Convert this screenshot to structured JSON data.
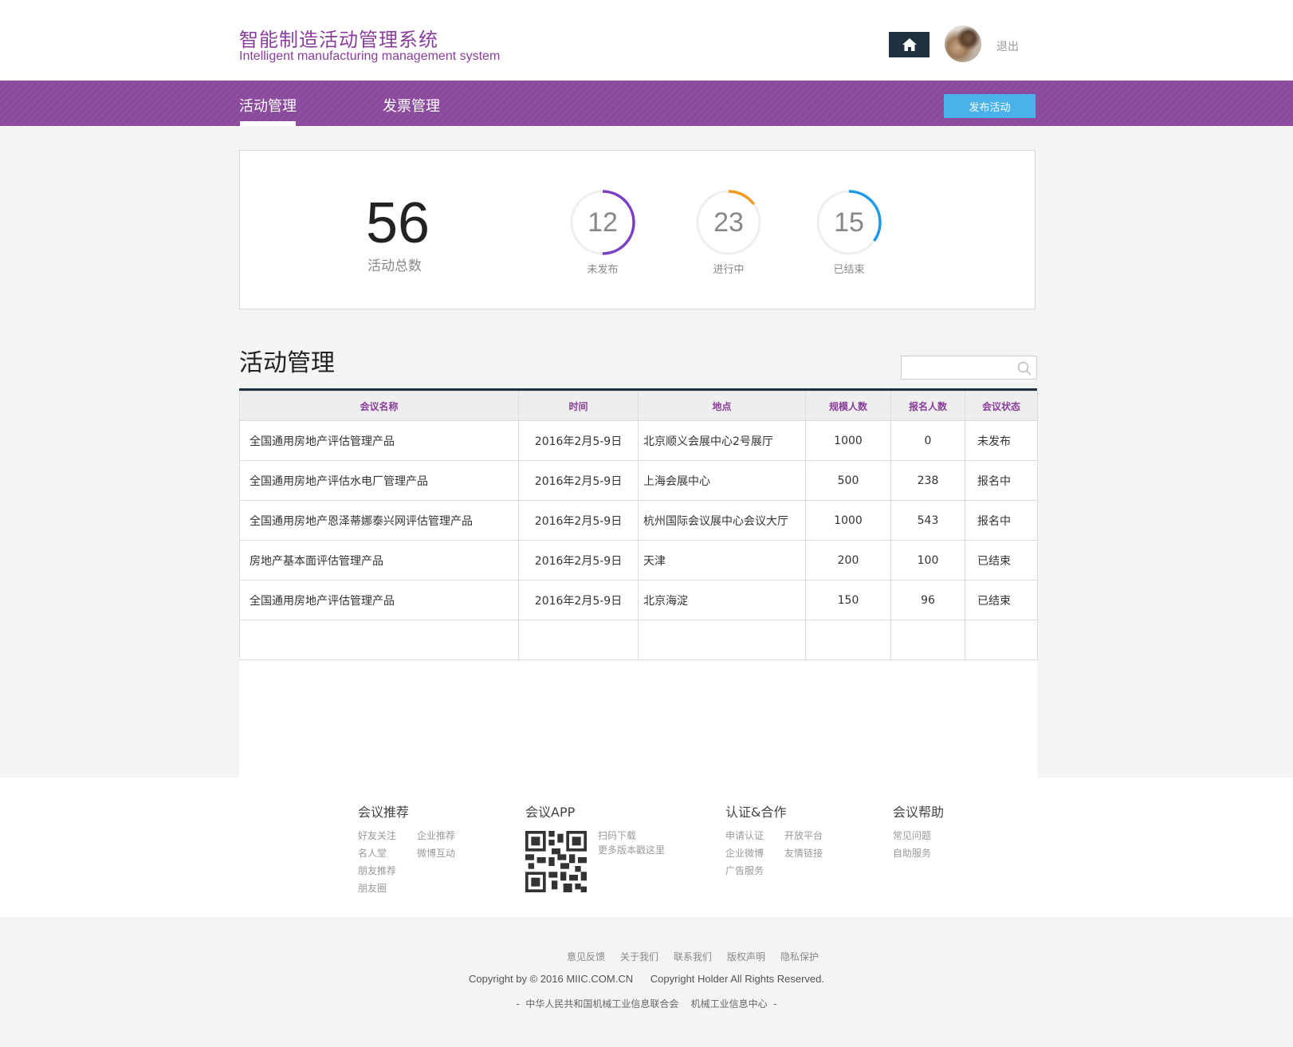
{
  "header": {
    "title": "智能制造活动管理系统",
    "subtitle": "Intelligent manufacturing management system",
    "logout_label": "退出"
  },
  "nav": {
    "tabs": [
      {
        "label": "活动管理",
        "active": true
      },
      {
        "label": "发票管理",
        "active": false
      }
    ],
    "publish_label": "发布活动"
  },
  "stats": {
    "total": {
      "value": "56",
      "label": "活动总数"
    },
    "rings": [
      {
        "value": "12",
        "label": "未发布",
        "color": "#7b3fc4",
        "fraction": 0.5
      },
      {
        "value": "23",
        "label": "进行中",
        "color": "#f39a1e",
        "fraction": 0.15
      },
      {
        "value": "15",
        "label": "已结束",
        "color": "#1e9be8",
        "fraction": 0.35
      }
    ]
  },
  "section": {
    "title": "活动管理",
    "search_placeholder": ""
  },
  "table": {
    "headers": [
      "会议名称",
      "时间",
      "地点",
      "规模人数",
      "报名人数",
      "会议状态"
    ],
    "rows": [
      [
        "全国通用房地产评估管理产品",
        "2016年2月5-9日",
        "北京顺义会展中心2号展厅",
        "1000",
        "0",
        "未发布"
      ],
      [
        "全国通用房地产评估水电厂管理产品",
        "2016年2月5-9日",
        "上海会展中心",
        "500",
        "238",
        "报名中"
      ],
      [
        "全国通用房地产恩泽蒂娜泰兴网评估管理产品",
        "2016年2月5-9日",
        "杭州国际会议展中心会议大厅",
        "1000",
        "543",
        "报名中"
      ],
      [
        "房地产基本面评估管理产品",
        "2016年2月5-9日",
        "天津",
        "200",
        "100",
        "已结束"
      ],
      [
        "全国通用房地产评估管理产品",
        "2016年2月5-9日",
        "北京海淀",
        "150",
        "96",
        "已结束"
      ]
    ]
  },
  "footer": {
    "cols": [
      {
        "title": "会议推荐",
        "links": [
          "好友关注",
          "企业推荐",
          "名人堂",
          "微博互动",
          "朋友推荐",
          "朋友圈"
        ]
      },
      {
        "title": "会议APP",
        "links": [
          "扫码下载",
          "更多版本戳这里"
        ]
      },
      {
        "title": "认证&合作",
        "links": [
          "申请认证",
          "开放平台",
          "企业微博",
          "友情链接",
          "广告服务"
        ]
      },
      {
        "title": "会议帮助",
        "links": [
          "常见问题",
          "自助服务"
        ]
      }
    ],
    "bottom_links": [
      "意见反馈",
      "关于我们",
      "联系我们",
      "版权声明",
      "隐私保护"
    ],
    "copyright": "Copyright by © 2016 MIIC.COM.CN      Copyright Holder All Rights Reserved.",
    "org_line": "-  中华人民共和国机械工业信息联合会    机械工业信息中心  -"
  },
  "icons": {
    "home": "home-icon",
    "search": "search-icon",
    "qr": "qr-code-icon"
  }
}
